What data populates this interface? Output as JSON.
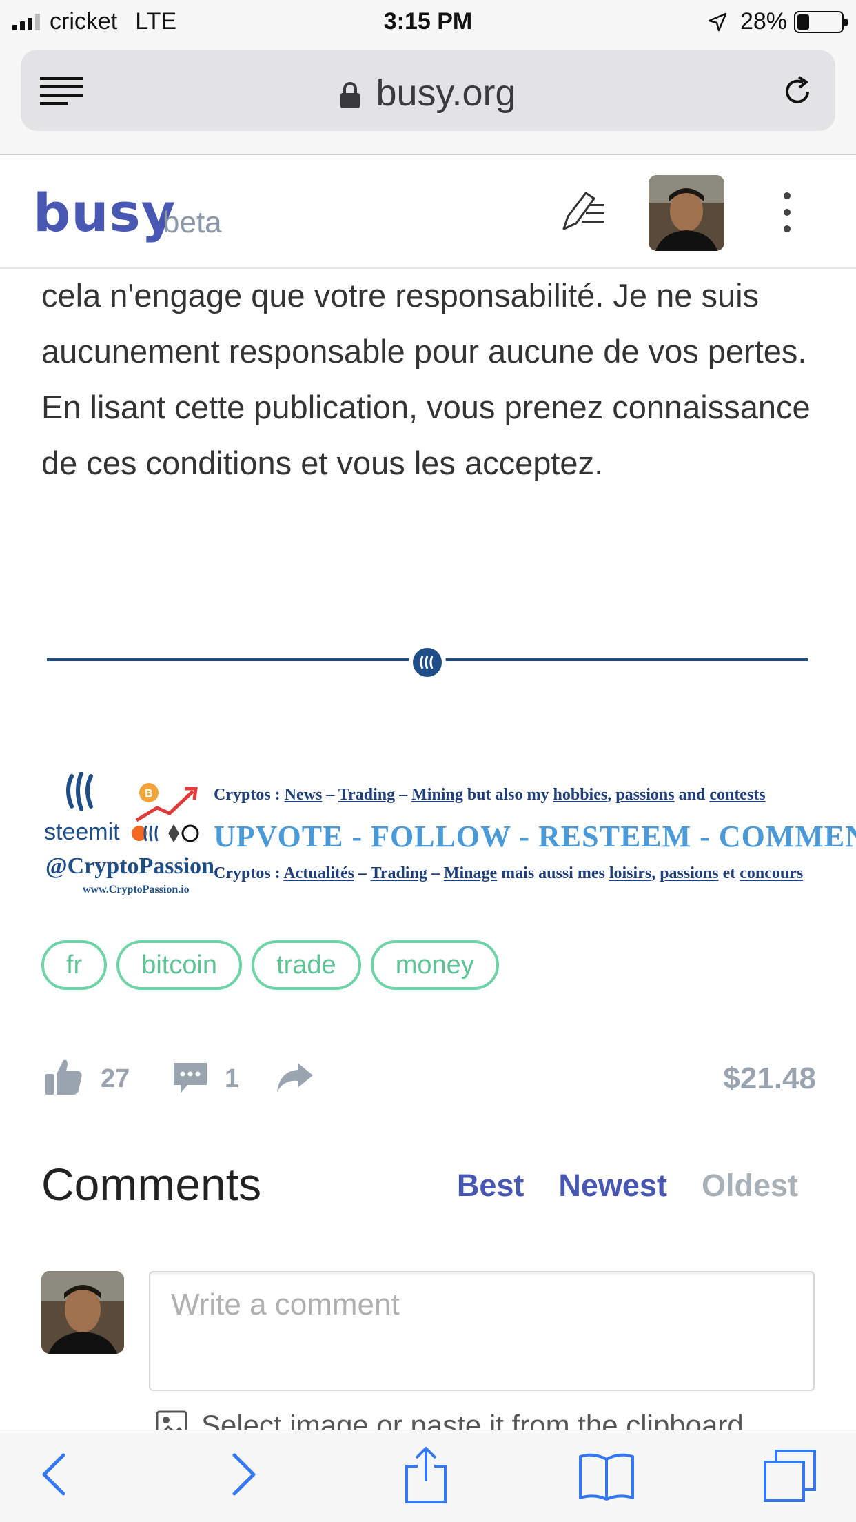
{
  "status_bar": {
    "carrier": "cricket",
    "network": "LTE",
    "time": "3:15 PM",
    "battery": "28%",
    "battery_level": 0.28
  },
  "browser": {
    "url": "busy.org"
  },
  "header": {
    "logo": "busy",
    "badge": "beta"
  },
  "article": {
    "text": "cela n'engage que votre responsabilité. Je ne suis aucunement responsable pour aucune de vos pertes. En lisant cette publication, vous prenez connaissance de ces conditions et vous les acceptez."
  },
  "banner": {
    "platform": "steemit",
    "handle": "@CryptoPassion",
    "site": "www.CryptoPassion.io",
    "line1_parts": [
      "Cryptos : ",
      "News",
      " – ",
      "Trading",
      " – ",
      "Mining",
      " but also my ",
      "hobbies",
      ", ",
      "passions",
      " and ",
      "contests"
    ],
    "line2": "UPVOTE  -  FOLLOW  -  RESTEEM  -  COMMENT",
    "line3_parts": [
      "Cryptos : ",
      "Actualités",
      " – ",
      "Trading",
      " – ",
      "Minage",
      " mais aussi mes ",
      "loisirs",
      ", ",
      "passions",
      " et ",
      "concours"
    ]
  },
  "tags": [
    "fr",
    "bitcoin",
    "trade",
    "money"
  ],
  "actions": {
    "likes": "27",
    "comments": "1",
    "payout": "$21.48"
  },
  "comments": {
    "title": "Comments",
    "sort": {
      "best": "Best",
      "newest": "Newest",
      "oldest": "Oldest"
    },
    "placeholder": "Write a comment",
    "upload_hint": "Select image or paste it from the clipboard"
  },
  "colors": {
    "brand": "#4757b2",
    "tag_green": "#5cc395",
    "steem_blue": "#1f4e86",
    "muted": "#9aa4ae"
  },
  "icons": [
    "reader-icon",
    "lock-icon",
    "reload-icon",
    "write-icon",
    "more-icon",
    "steem-icon",
    "like-icon",
    "comment-icon",
    "share-icon",
    "image-icon",
    "back-icon",
    "forward-icon",
    "share-sheet-icon",
    "bookmarks-icon",
    "tabs-icon"
  ]
}
